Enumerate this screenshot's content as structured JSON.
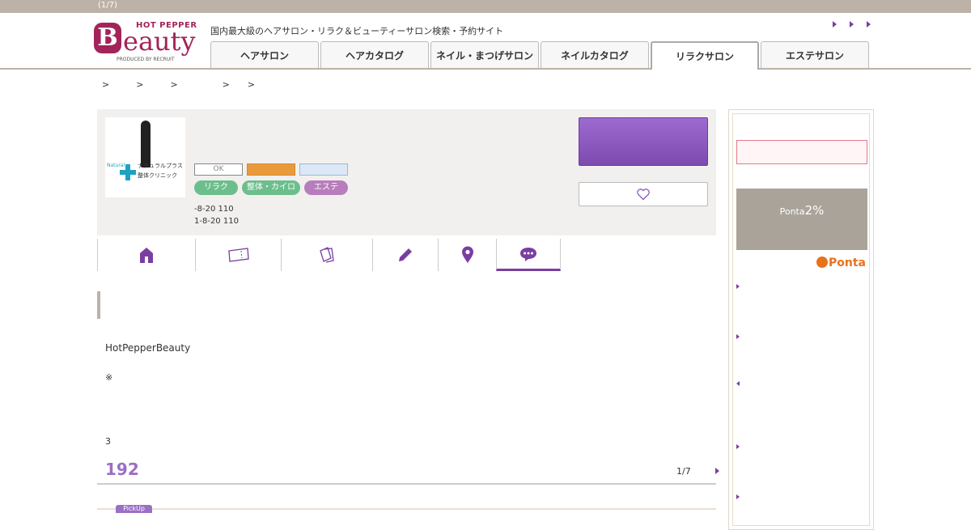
{
  "topbar": {
    "page_indicator": "(1/7)"
  },
  "header": {
    "logo": {
      "hot_pepper": "HOT PEPPER",
      "b": "B",
      "eauty": "eauty",
      "produced_by": "PRODUCED BY RECRUIT"
    },
    "tagline": "国内最大級のヘアサロン・リラク＆ビューティーサロン検索・予約サイト",
    "tabs": [
      {
        "label": "ヘアサロン"
      },
      {
        "label": "ヘアカタログ"
      },
      {
        "label": "ネイル・まつげサロン"
      },
      {
        "label": "ネイルカタログ"
      },
      {
        "label": "リラクサロン"
      },
      {
        "label": "エステサロン"
      }
    ],
    "active_tab": "リラクサロン"
  },
  "breadcrumb": [
    ">",
    ">",
    ">",
    ">",
    ">"
  ],
  "salon": {
    "thumbnail": {
      "brand": "Natural",
      "name": "ナチュラルプラス 整体クリニック"
    },
    "badge_ok": "OK",
    "categories": [
      "リラク",
      "整体・カイロ",
      "エステ"
    ],
    "address_lines": [
      "-8-20 110",
      "1-8-20 110"
    ]
  },
  "subnav": [
    {
      "icon": "home-icon"
    },
    {
      "icon": "coupon-icon"
    },
    {
      "icon": "catalog-icon"
    },
    {
      "icon": "pencil-icon"
    },
    {
      "icon": "map-pin-icon"
    },
    {
      "icon": "review-bubble-icon"
    }
  ],
  "review": {
    "p1": "HotPepperBeauty",
    "p2": "※",
    "p3": "3",
    "count": "192",
    "pager": "1/7",
    "pickup_label": "PickUp"
  },
  "sidebar": {
    "ponta": {
      "prefix": "Ponta",
      "rate": "2%",
      "logo": "Ponta"
    }
  },
  "colors": {
    "accent": "#7a3ea0",
    "brand": "#a3245a",
    "reserve": "#8b58bf"
  }
}
